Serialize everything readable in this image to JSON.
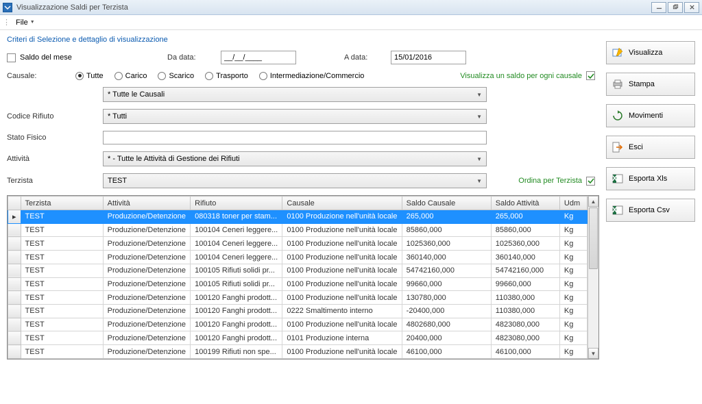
{
  "window": {
    "title": "Visualizzazione Saldi per Terzista"
  },
  "menu": {
    "file": "File"
  },
  "criteria": {
    "title": "Criteri di Selezione e dettaglio di visualizzazione",
    "saldo_mese": "Saldo del mese",
    "da_data": "Da data:",
    "da_data_val": "__/__/____",
    "a_data": "A data:",
    "a_data_val": "15/01/2016",
    "causale_label": "Causale:",
    "radios": {
      "tutte": "Tutte",
      "carico": "Carico",
      "scarico": "Scarico",
      "trasporto": "Trasporto",
      "intermed": "Intermediazione/Commercio"
    },
    "visualizza_saldo": "Visualizza un saldo per ogni causale",
    "causali_combo": "* Tutte le Causali",
    "codice_rifiuto": "Codice Rifiuto",
    "codice_rifiuto_val": "* Tutti",
    "stato_fisico": "Stato Fisico",
    "stato_fisico_val": "",
    "attivita": "Attività",
    "attivita_val": "* - Tutte le Attività di Gestione dei Rifiuti",
    "terzista": "Terzista",
    "terzista_val": "TEST",
    "ordina_terzista": "Ordina per Terzista"
  },
  "buttons": {
    "visualizza": "Visualizza",
    "stampa": "Stampa",
    "movimenti": "Movimenti",
    "esci": "Esci",
    "esporta_xls": "Esporta Xls",
    "esporta_csv": "Esporta Csv"
  },
  "grid": {
    "columns": {
      "terzista": "Terzista",
      "attivita": "Attività",
      "rifiuto": "Rifiuto",
      "causale": "Causale",
      "saldo_causale": "Saldo Causale",
      "saldo_attivita": "Saldo Attività",
      "udm": "Udm"
    },
    "rows": [
      {
        "terzista": "TEST",
        "attivita": "Produzione/Detenzione",
        "rifiuto": "080318 toner per stam...",
        "causale": "0100 Produzione nell'unità locale",
        "saldo_c": "265,000",
        "saldo_a": "265,000",
        "udm": "Kg"
      },
      {
        "terzista": "TEST",
        "attivita": "Produzione/Detenzione",
        "rifiuto": "100104 Ceneri leggere...",
        "causale": "0100 Produzione nell'unità locale",
        "saldo_c": "85860,000",
        "saldo_a": "85860,000",
        "udm": "Kg"
      },
      {
        "terzista": "TEST",
        "attivita": "Produzione/Detenzione",
        "rifiuto": "100104 Ceneri leggere...",
        "causale": "0100 Produzione nell'unità locale",
        "saldo_c": "1025360,000",
        "saldo_a": "1025360,000",
        "udm": "Kg"
      },
      {
        "terzista": "TEST",
        "attivita": "Produzione/Detenzione",
        "rifiuto": "100104 Ceneri leggere...",
        "causale": "0100 Produzione nell'unità locale",
        "saldo_c": "360140,000",
        "saldo_a": "360140,000",
        "udm": "Kg"
      },
      {
        "terzista": "TEST",
        "attivita": "Produzione/Detenzione",
        "rifiuto": "100105 Rifiuti solidi pr...",
        "causale": "0100 Produzione nell'unità locale",
        "saldo_c": "54742160,000",
        "saldo_a": "54742160,000",
        "udm": "Kg"
      },
      {
        "terzista": "TEST",
        "attivita": "Produzione/Detenzione",
        "rifiuto": "100105 Rifiuti solidi pr...",
        "causale": "0100 Produzione nell'unità locale",
        "saldo_c": "99660,000",
        "saldo_a": "99660,000",
        "udm": "Kg"
      },
      {
        "terzista": "TEST",
        "attivita": "Produzione/Detenzione",
        "rifiuto": "100120 Fanghi prodott...",
        "causale": "0100 Produzione nell'unità locale",
        "saldo_c": "130780,000",
        "saldo_a": "110380,000",
        "udm": "Kg"
      },
      {
        "terzista": "TEST",
        "attivita": "Produzione/Detenzione",
        "rifiuto": "100120 Fanghi prodott...",
        "causale": "0222 Smaltimento interno",
        "saldo_c": "-20400,000",
        "saldo_a": "110380,000",
        "udm": "Kg"
      },
      {
        "terzista": "TEST",
        "attivita": "Produzione/Detenzione",
        "rifiuto": "100120 Fanghi prodott...",
        "causale": "0100 Produzione nell'unità locale",
        "saldo_c": "4802680,000",
        "saldo_a": "4823080,000",
        "udm": "Kg"
      },
      {
        "terzista": "TEST",
        "attivita": "Produzione/Detenzione",
        "rifiuto": "100120 Fanghi prodott...",
        "causale": "0101 Produzione interna",
        "saldo_c": "20400,000",
        "saldo_a": "4823080,000",
        "udm": "Kg"
      },
      {
        "terzista": "TEST",
        "attivita": "Produzione/Detenzione",
        "rifiuto": "100199 Rifiuti non spe...",
        "causale": "0100 Produzione nell'unità locale",
        "saldo_c": "46100,000",
        "saldo_a": "46100,000",
        "udm": "Kg"
      }
    ]
  }
}
